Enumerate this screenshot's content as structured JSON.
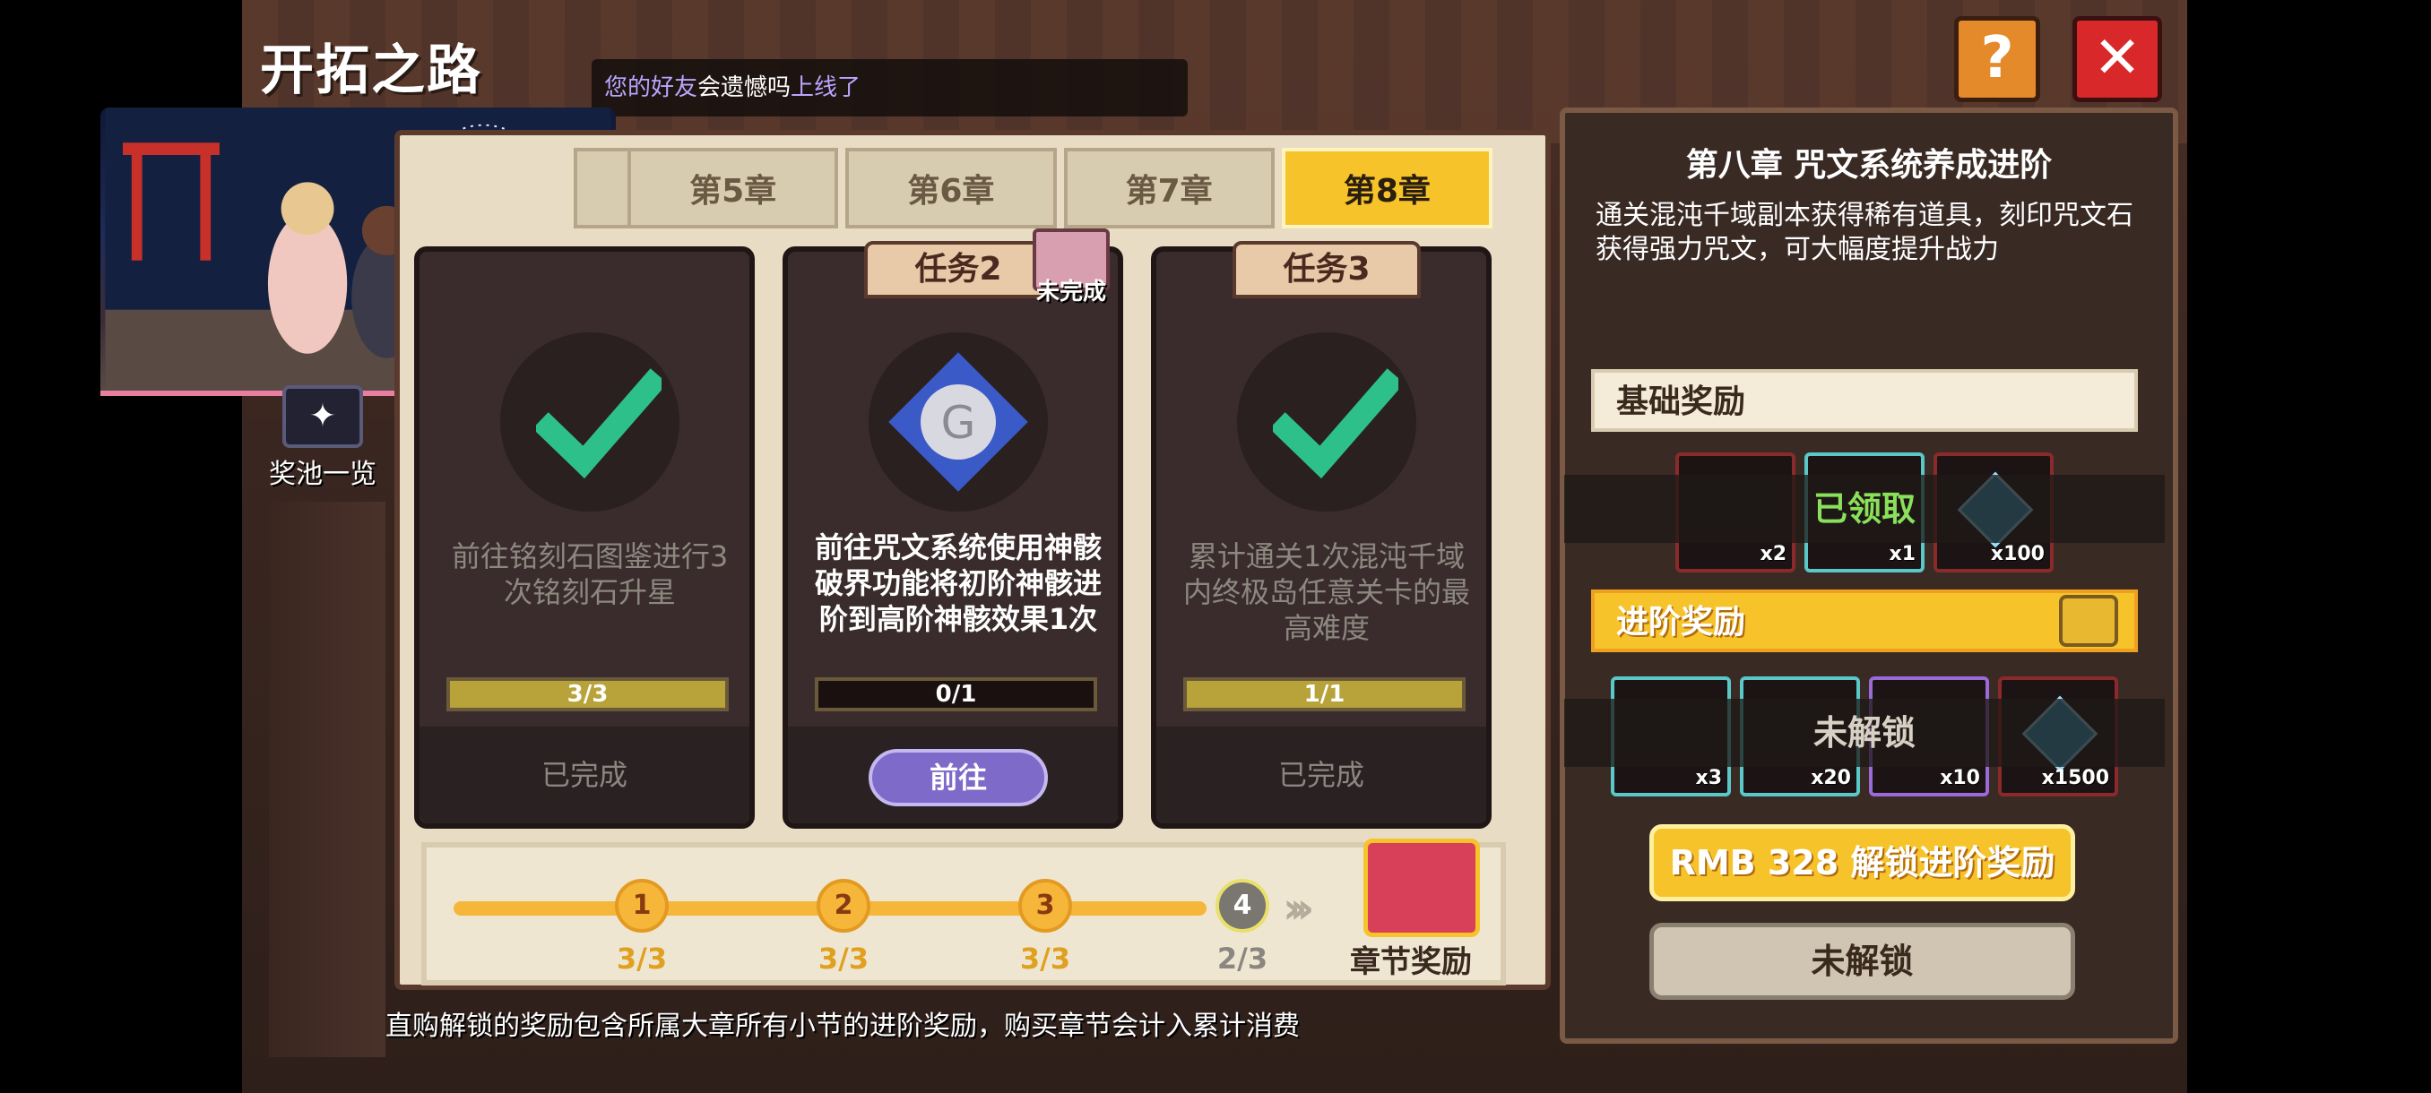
{
  "header": {
    "title": "开拓之路"
  },
  "notification": {
    "prefix": "您的好友",
    "middle": "会遗憾吗",
    "suffix": "上线了"
  },
  "pool": {
    "label": "奖池一览"
  },
  "tabs": [
    {
      "label": "第5章",
      "active": false
    },
    {
      "label": "第6章",
      "active": false
    },
    {
      "label": "第7章",
      "active": false
    },
    {
      "label": "第8章",
      "active": true
    }
  ],
  "tasks": [
    {
      "tag": "",
      "description": "前往铭刻石图鉴进行3次铭刻石升星",
      "progress": "3/3",
      "progress_value": 1.0,
      "status": "已完成",
      "completed": true
    },
    {
      "tag": "任务2",
      "description": "前往咒文系统使用神骸破界功能将初阶神骸进阶到高阶神骸效果1次",
      "progress": "0/1",
      "progress_value": 0.0,
      "action": "前往",
      "badge": "未完成",
      "completed": false
    },
    {
      "tag": "任务3",
      "description": "累计通关1次混沌千域内终极岛任意关卡的最高难度",
      "progress": "1/1",
      "progress_value": 1.0,
      "status": "已完成",
      "completed": true
    }
  ],
  "track": {
    "nodes": [
      {
        "num": "1",
        "count": "3/3"
      },
      {
        "num": "2",
        "count": "3/3"
      },
      {
        "num": "3",
        "count": "3/3"
      },
      {
        "num": "4",
        "count": "2/3"
      }
    ],
    "chapter_reward_label": "章节奖励"
  },
  "bottom_note": "直购解锁的奖励包含所属大章所有小节的进阶奖励，购买章节会计入累计消费",
  "right_panel": {
    "title": "第八章 咒文系统养成进阶",
    "description": "通关混沌千域副本获得稀有道具，刻印咒文石获得强力咒文，可大幅度提升战力",
    "basic_label": "基础奖励",
    "basic_items": [
      {
        "qty": "x2"
      },
      {
        "qty": "x1"
      },
      {
        "qty": "x100"
      }
    ],
    "claimed_label": "已领取",
    "advanced_label": "进阶奖励",
    "advanced_items": [
      {
        "qty": "x3"
      },
      {
        "qty": "x20"
      },
      {
        "qty": "x10"
      },
      {
        "qty": "x1500"
      }
    ],
    "locked_overlay": "未解锁",
    "buy_button": "RMB 328 解锁进阶奖励",
    "locked_button": "未解锁"
  },
  "buttons": {
    "help": "?",
    "close": "✕"
  },
  "colors": {
    "accent": "#f6c32a",
    "close": "#d8282a",
    "help": "#e58a2a",
    "claimed": "#8ae05a",
    "go": "#7e6ac8"
  }
}
